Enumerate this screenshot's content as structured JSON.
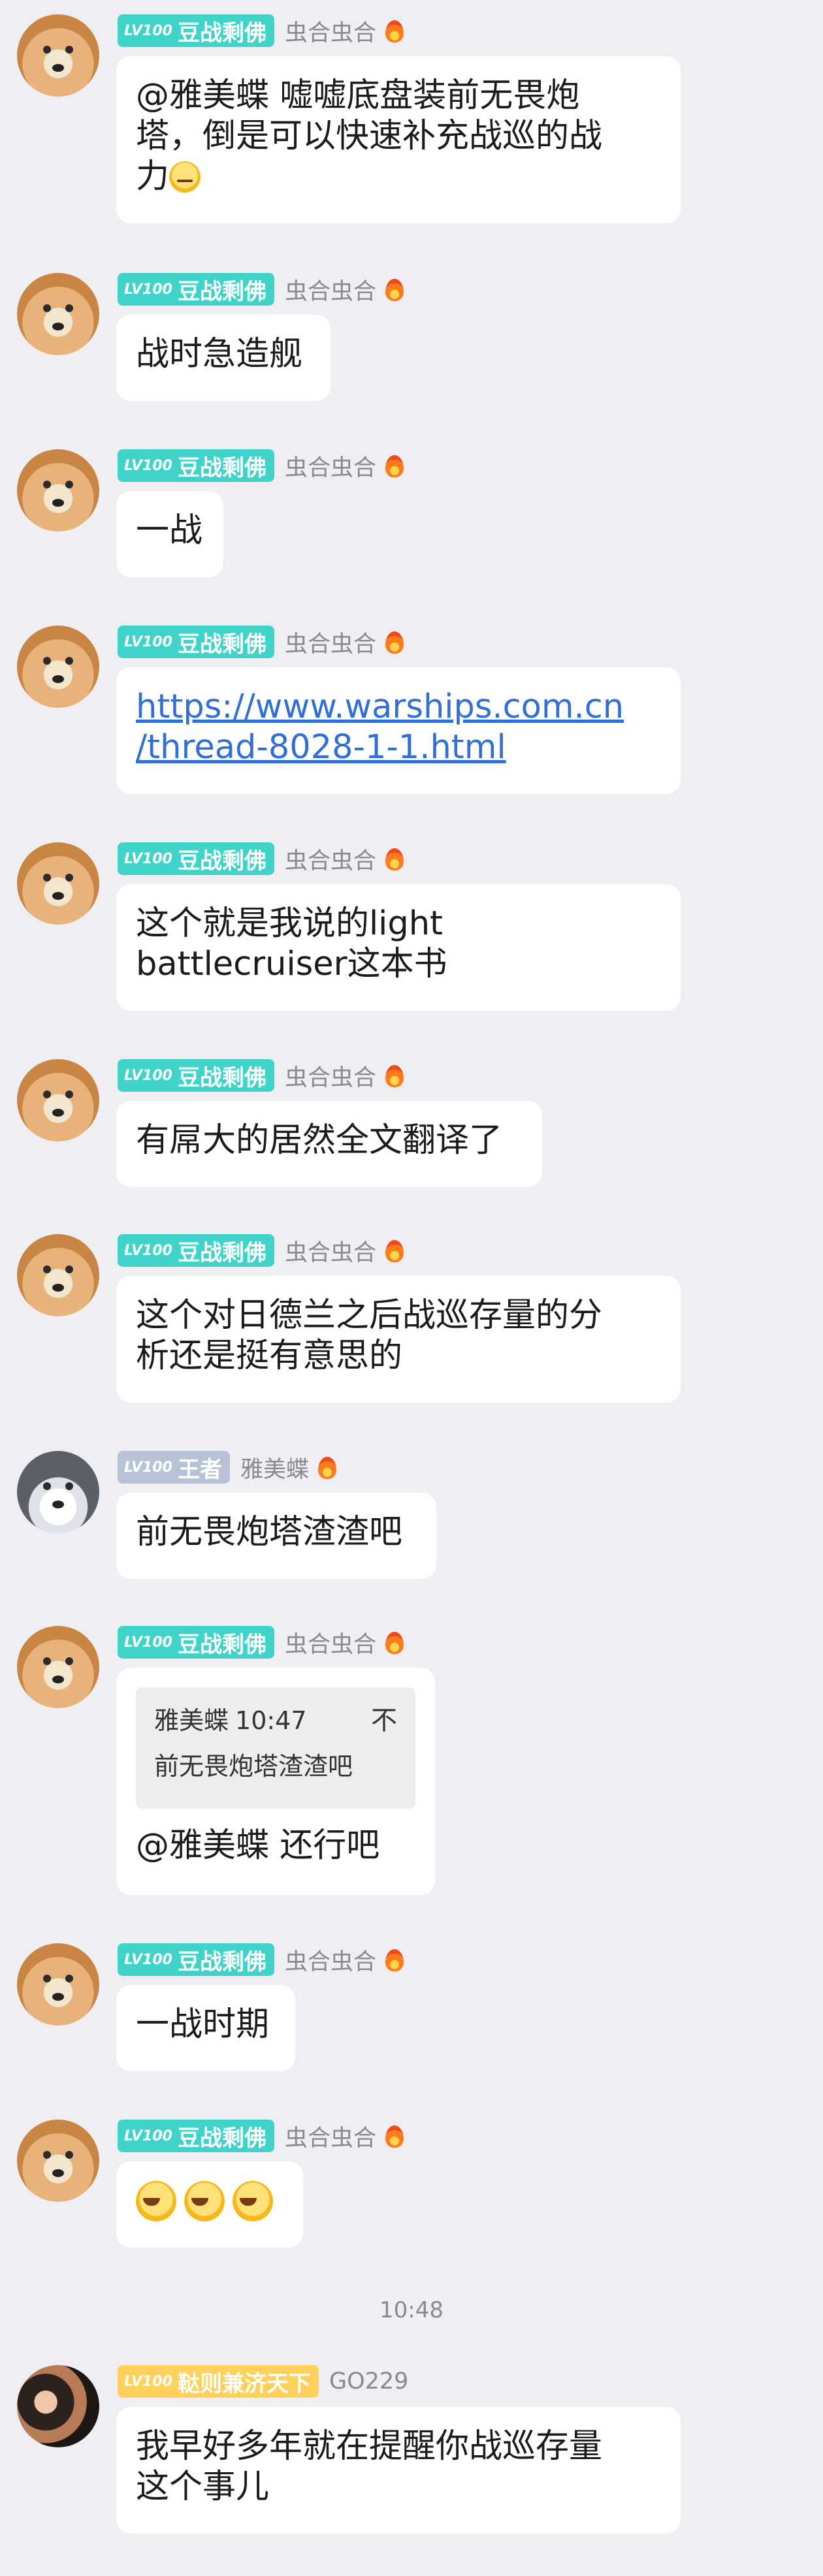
{
  "badges": {
    "lv": "LV100",
    "doudou": "豆战剩佛",
    "wangzhe": "王者",
    "go": "鞑则兼济天下"
  },
  "nicks": {
    "huohe": "虫合虫合",
    "yameidie": "雅美蝶",
    "go229": "GO229"
  },
  "messages": [
    {
      "lines": [
        "@雅美蝶 嘘嘘底盘装前无畏炮",
        "塔，倒是可以快速补充战巡的战",
        "力"
      ],
      "trailing_emoji": "smirk"
    },
    {
      "lines": [
        "战时急造舰"
      ]
    },
    {
      "lines": [
        "一战"
      ]
    },
    {
      "link_lines": [
        "https://www.warships.com.cn",
        "/thread-8028-1-1.html"
      ]
    },
    {
      "lines": [
        "这个就是我说的light",
        "battlecruiser这本书"
      ]
    },
    {
      "lines": [
        "有屌大的居然全文翻译了"
      ]
    },
    {
      "lines": [
        "这个对日德兰之后战巡存量的分",
        "析还是挺有意思的"
      ]
    },
    {
      "lines": [
        "前无畏炮塔渣渣吧"
      ]
    },
    {
      "quote": {
        "author": "雅美蝶",
        "time": "10:47",
        "collapse": "不",
        "text": "前无畏炮塔渣渣吧"
      },
      "lines": [
        "@雅美蝶 还行吧"
      ]
    },
    {
      "lines": [
        "一战时期"
      ]
    },
    {
      "emojis": [
        "grin",
        "grin",
        "grin"
      ]
    },
    {
      "lines": [
        "我早好多年就在提醒你战巡存量",
        "这个事儿"
      ]
    }
  ],
  "timestamp": "10:48",
  "icons": {
    "level_badge": "level-badge-icon",
    "fire": "fire-icon",
    "emoji_smirk": "smirk-emoji-icon",
    "emoji_grin": "grin-emoji-icon"
  },
  "colors": {
    "background": "#eeeef3",
    "bubble": "#ffffff",
    "teal_badge": "#3fd3c9",
    "grey_badge": "#b7c2d6",
    "gold_badge": "#ffd15a",
    "link": "#2f6fd6",
    "meta_text": "#8a8a8e"
  }
}
